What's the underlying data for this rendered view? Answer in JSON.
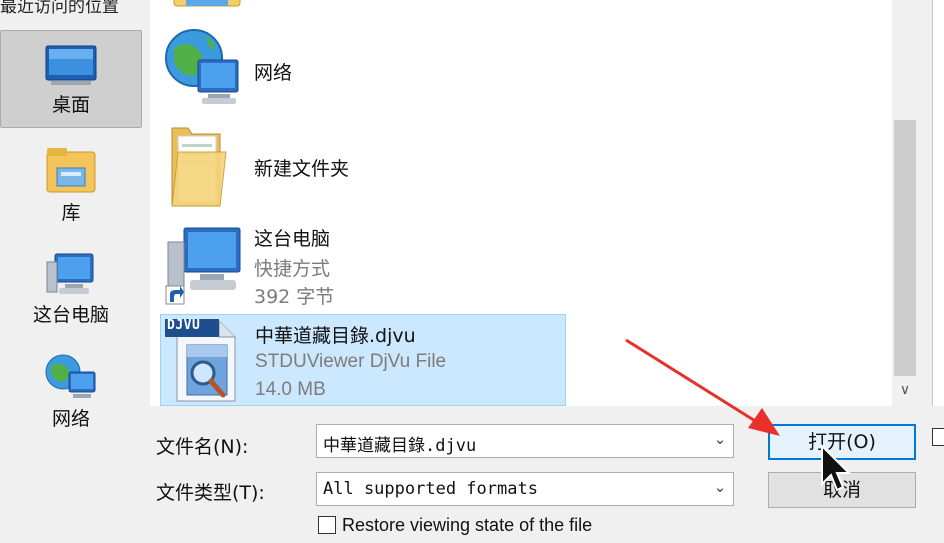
{
  "nav": {
    "top_label": "最近访问的位置",
    "items": [
      {
        "label": "桌面",
        "icon": "desktop-icon",
        "selected": true
      },
      {
        "label": "库",
        "icon": "library-icon",
        "selected": false
      },
      {
        "label": "这台电脑",
        "icon": "computer-icon",
        "selected": false
      },
      {
        "label": "网络",
        "icon": "network-icon",
        "selected": false
      }
    ]
  },
  "files": [
    {
      "name": "网络",
      "icon": "network-icon"
    },
    {
      "name": "新建文件夹",
      "icon": "folder-icon"
    },
    {
      "name": "这台电脑",
      "line2": "快捷方式",
      "line3": "392 字节",
      "icon": "computer-shortcut-icon"
    },
    {
      "name": "中華道藏目錄.djvu",
      "line2": "STDUViewer DjVu File",
      "line3": "14.0 MB",
      "icon": "djvu-file-icon",
      "selected": true,
      "badge": "DJVU"
    }
  ],
  "form": {
    "filename_label": "文件名(N):",
    "filename_value": "中華道藏目錄.djvu",
    "filetype_label": "文件类型(T):",
    "filetype_value": "All supported formats",
    "open_button": "打开(O)",
    "cancel_button": "取消",
    "restore_label": "Restore viewing state of the file",
    "restore_checked": false
  },
  "colors": {
    "selection_bg": "#cce8ff",
    "selection_border": "#99d1ff",
    "accent": "#0078d7",
    "annotation_arrow": "#e8312a"
  }
}
